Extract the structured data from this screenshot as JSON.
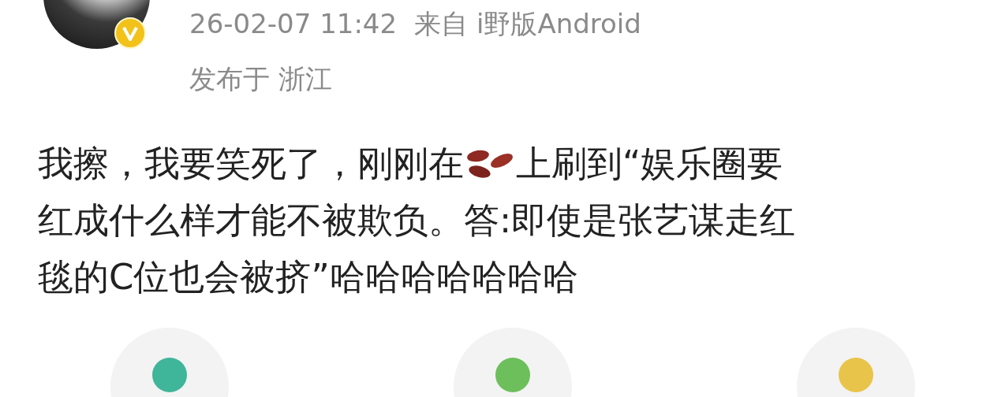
{
  "post": {
    "timestamp": "26-02-07 11:42",
    "source": "来自 i野版Android",
    "location": "发布于 浙江",
    "body": [
      [
        "我擦，我要笑死了，刚刚在",
        "上刷到“娱乐圈要"
      ],
      [
        "红成什么样才能不被欺负。答:即使是张艺谋走红"
      ],
      [
        "毯的C位也会被挤”哈哈哈哈哈哈哈"
      ]
    ],
    "actions": [
      {
        "color": "#3fb59a"
      },
      {
        "color": "#6cbf5a"
      },
      {
        "color": "#e8c44a"
      }
    ]
  }
}
